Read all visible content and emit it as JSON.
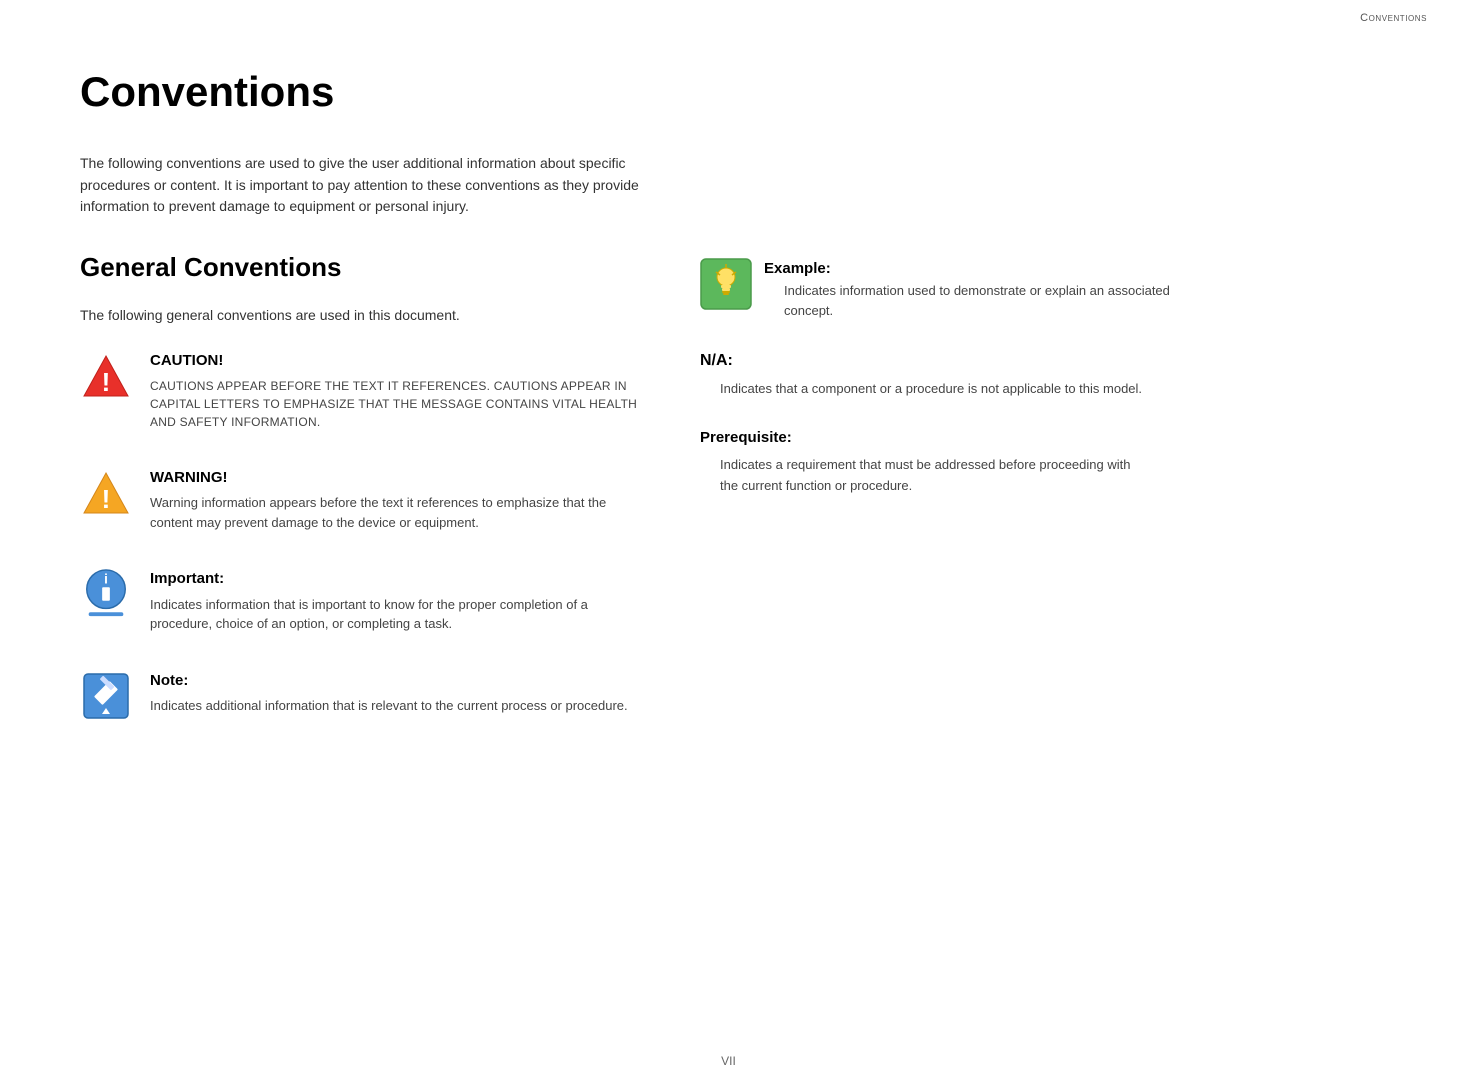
{
  "header": {
    "right_label": "Conventions"
  },
  "page": {
    "title": "Conventions",
    "intro": "The following conventions are used to give the user additional information about specific procedures or content. It is important to pay attention to these conventions as they provide information to prevent damage to equipment or personal injury.",
    "general_section_title": "General Conventions",
    "general_subtitle": "The following general conventions are used in this document."
  },
  "left_items": [
    {
      "id": "caution",
      "title": "CAUTION!",
      "desc": "CAUTIONS APPEAR BEFORE THE TEXT IT REFERENCES. CAUTIONS APPEAR IN CAPITAL LETTERS TO EMPHASIZE THAT THE MESSAGE CONTAINS VITAL HEALTH AND SAFETY INFORMATION.",
      "icon_type": "caution"
    },
    {
      "id": "warning",
      "title": "WARNING!",
      "desc": "Warning information appears before the text it references to emphasize that the content may prevent damage to the device or equipment.",
      "icon_type": "warning"
    },
    {
      "id": "important",
      "title": "Important:",
      "desc": "Indicates information that is important to know for the proper completion of a procedure, choice of an option, or completing a task.",
      "icon_type": "important"
    },
    {
      "id": "note",
      "title": "Note:",
      "desc": "Indicates additional information that is relevant to the current process or procedure.",
      "icon_type": "note"
    }
  ],
  "right_items": [
    {
      "id": "example",
      "title": "Example:",
      "desc": "Indicates information used to demonstrate or explain an associated concept.",
      "icon_type": "example",
      "has_icon": true
    },
    {
      "id": "na",
      "title": "N/A:",
      "desc": "Indicates that a component or a procedure is not applicable to this model.",
      "has_icon": false
    },
    {
      "id": "prerequisite",
      "title": "Prerequisite:",
      "desc": "Indicates a requirement that must be addressed before proceeding with the current function or procedure.",
      "has_icon": false
    }
  ],
  "footer": {
    "page_number": "VII"
  }
}
